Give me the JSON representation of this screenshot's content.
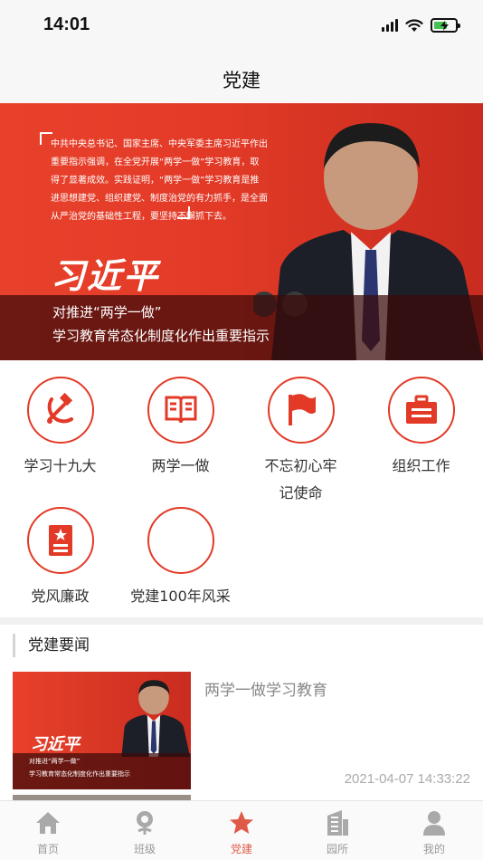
{
  "status_bar": {
    "time": "14:01"
  },
  "nav": {
    "title": "党建"
  },
  "banner": {
    "quote": "中共中央总书记、国家主席、中央军委主席习近平作出重要指示强调，在全党开展“两学一做”学习教育，取得了显著成效。实践证明，“两学一做”学习教育是推进思想建党、组织建党、制度治党的有力抓手，是全面从严治党的基础性工程，要坚持不懈抓下去。",
    "name": "习近平",
    "line1": "对推进“两学一做”",
    "line2": "学习教育常态化制度化作出重要指示"
  },
  "grid": {
    "items": [
      {
        "label": "学习十九大",
        "icon": "hammer-sickle-icon"
      },
      {
        "label": "两学一做",
        "icon": "open-book-icon"
      },
      {
        "label": "不忘初心牢记使命",
        "icon": "flag-icon"
      },
      {
        "label": "组织工作",
        "icon": "briefcase-icon"
      },
      {
        "label": "党风廉政",
        "icon": "star-document-icon"
      },
      {
        "label": "党建100年风采",
        "icon": ""
      }
    ]
  },
  "section": {
    "title": "党建要闻"
  },
  "news": [
    {
      "title": "两学一做学习教育",
      "time": "2021-04-07 14:33:22",
      "thumb_name": "习近平",
      "thumb_line1": "对推进“两学一做”",
      "thumb_line2": "学习教育常态化制度化作出重要指示"
    }
  ],
  "tabs": [
    {
      "label": "首页",
      "icon": "home-icon"
    },
    {
      "label": "班级",
      "icon": "flower-icon"
    },
    {
      "label": "党建",
      "icon": "star-icon",
      "active": true
    },
    {
      "label": "园所",
      "icon": "building-icon"
    },
    {
      "label": "我的",
      "icon": "person-icon"
    }
  ],
  "colors": {
    "accent": "#e23a27",
    "active_tab": "#e05a4a",
    "inactive_tab": "#999999"
  }
}
